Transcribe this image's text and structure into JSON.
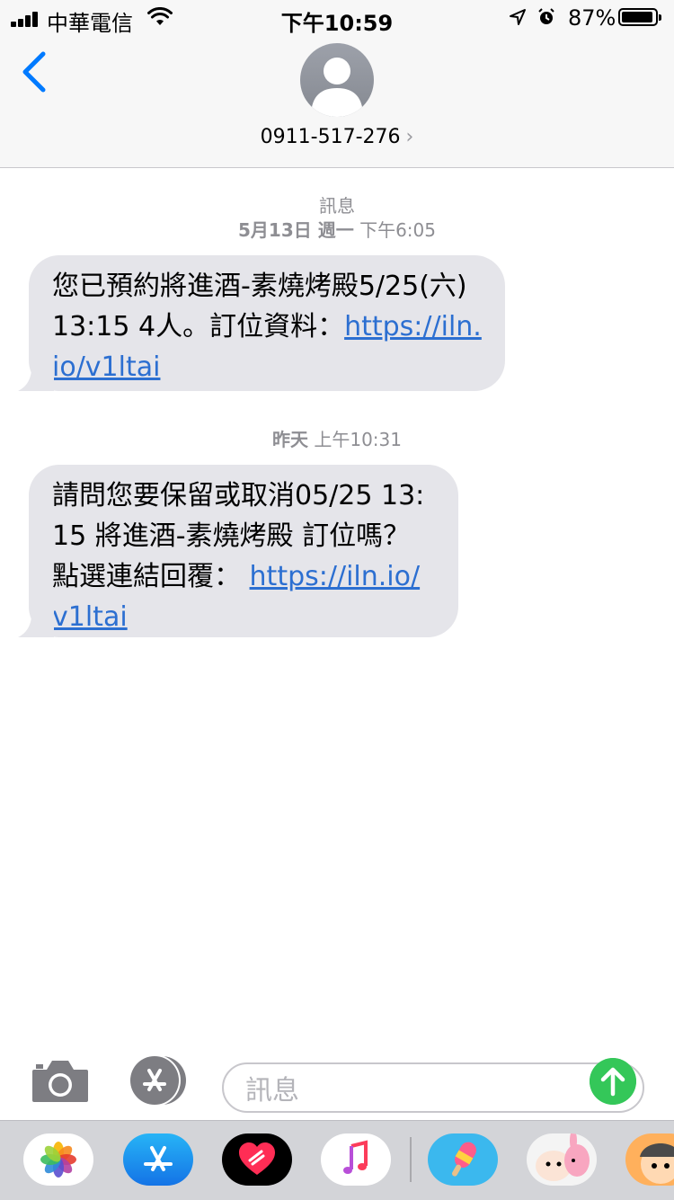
{
  "status_bar": {
    "carrier": "中華電信",
    "time": "下午10:59",
    "battery": "87%",
    "battery_level": 0.87
  },
  "header": {
    "contact": "0911-517-276",
    "icons": [
      "back-chevron-icon",
      "contact-avatar-icon",
      "chevron-right-icon"
    ]
  },
  "conversation": {
    "service_label": "訊息",
    "messages": [
      {
        "date": "5月13日 週一",
        "time": "下午6:05",
        "text": "您已預約將進酒-素燒烤殿5/25(六)13:15 4人。訂位資料：",
        "link": "https://iln.io/v1ltai"
      },
      {
        "date": "昨天",
        "time": "上午10:31",
        "text": "請問您要保留或取消05/25 13:15 將進酒-素燒烤殿 訂位嗎？點選連結回覆： ",
        "link": "https://iln.io/v1ltai"
      }
    ]
  },
  "compose": {
    "placeholder": "訊息",
    "icons": [
      "camera-icon",
      "app-store-icon",
      "send-arrow-icon"
    ]
  },
  "app_drawer": {
    "apps": [
      "photos",
      "app-store",
      "digital-touch",
      "music",
      "popsicle-stickers",
      "kanahei-stickers",
      "character-stickers"
    ]
  },
  "colors": {
    "bubble": "#e5e5ea",
    "link": "#2c6fd1",
    "ios_blue": "#007aff",
    "send_green": "#34c759",
    "meta_gray": "#8e8e93"
  }
}
